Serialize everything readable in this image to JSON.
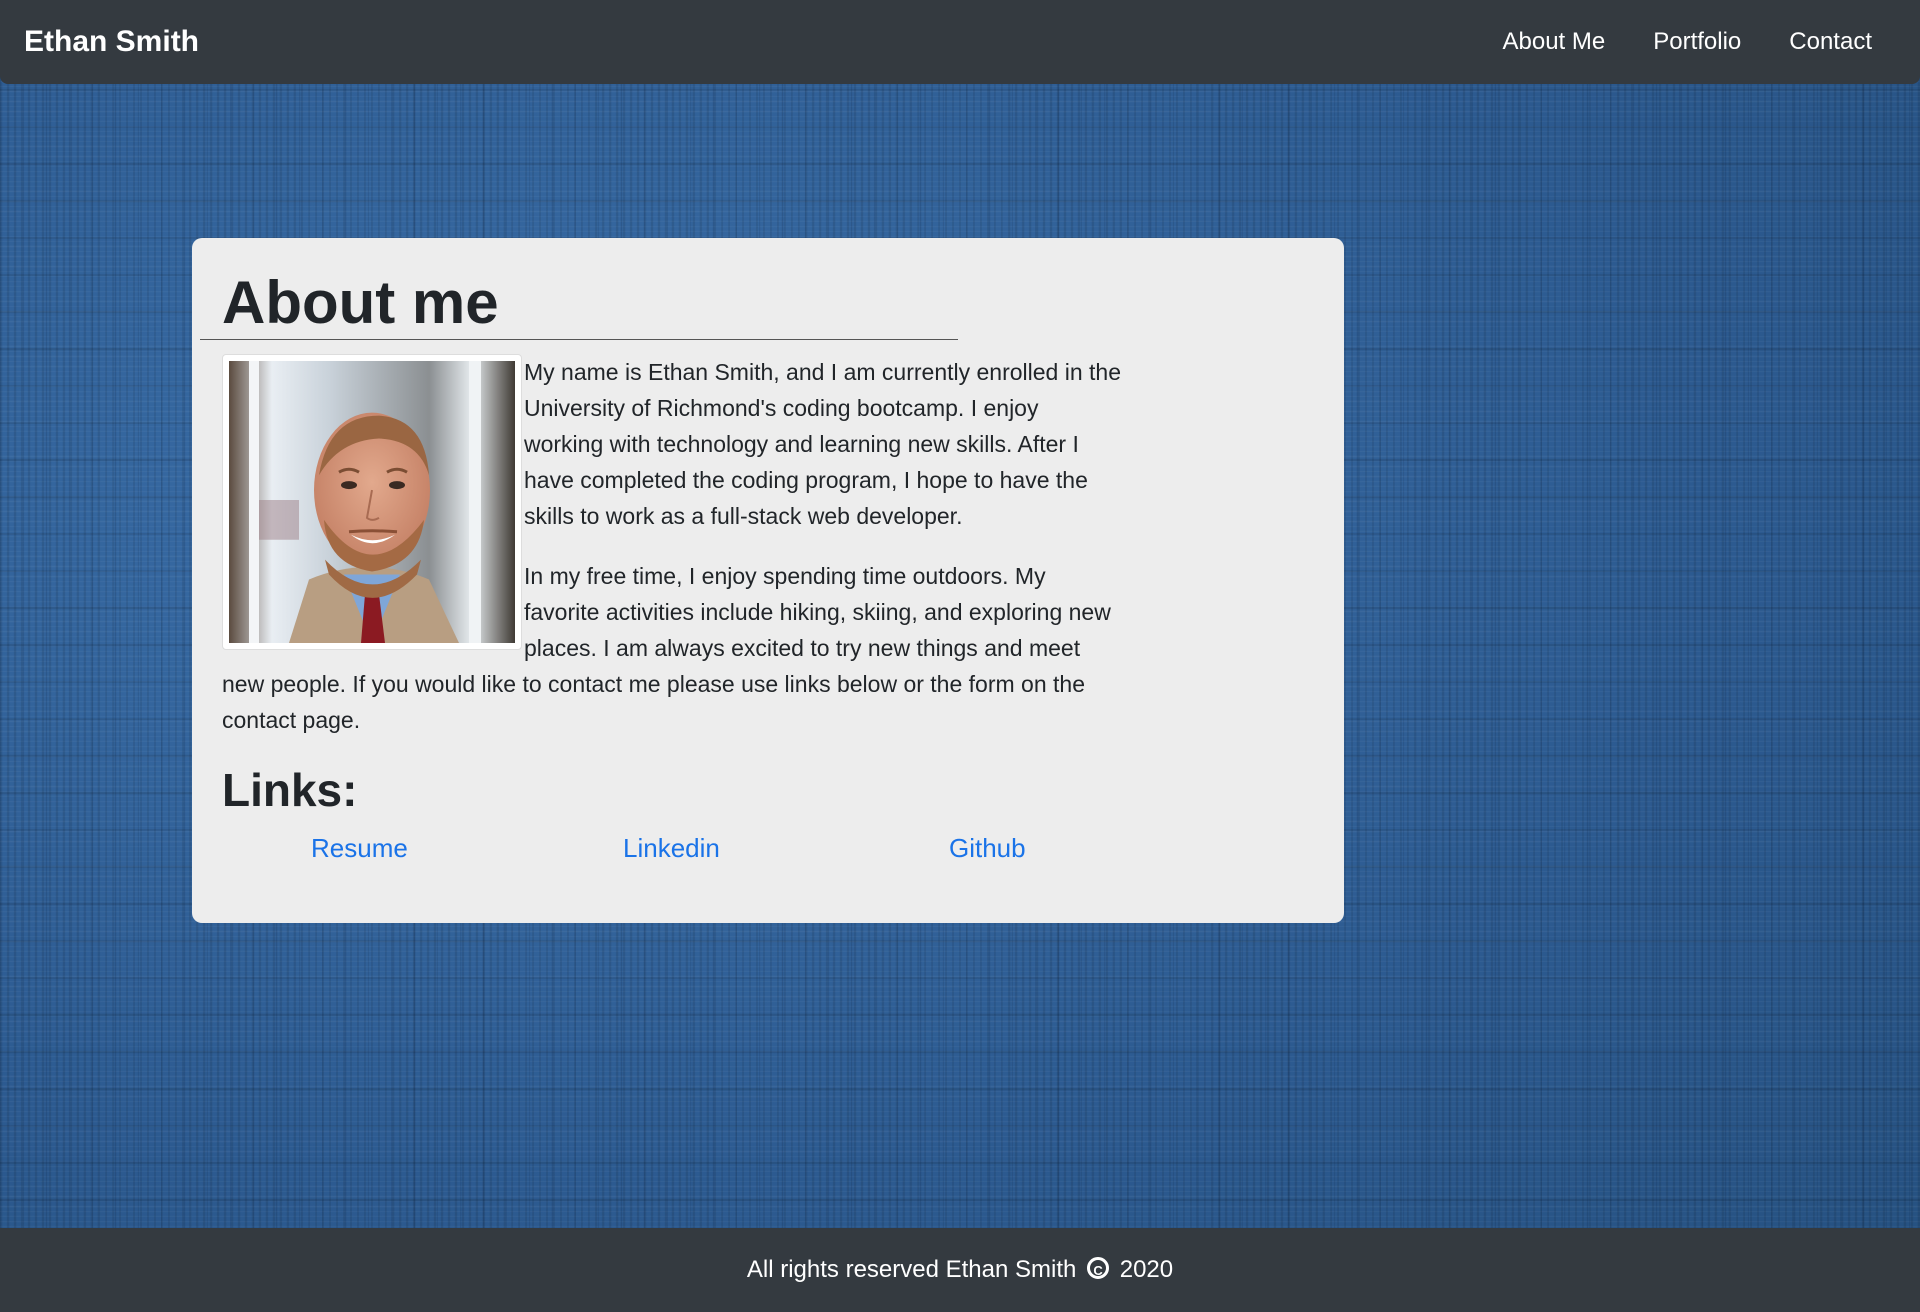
{
  "navbar": {
    "brand": "Ethan Smith",
    "links": [
      {
        "label": "About Me"
      },
      {
        "label": "Portfolio"
      },
      {
        "label": "Contact"
      }
    ]
  },
  "about": {
    "title": "About me",
    "paragraph_1": "My name is Ethan Smith, and I am currently enrolled in the University of Richmond's coding bootcamp. I enjoy working with technology and learning new skills. After I have completed the coding program, I hope to have the skills to work as a full-stack web developer.",
    "paragraph_2": "In my free time, I enjoy spending time outdoors. My favorite activities include hiking, skiing, and exploring new places. I am always excited to try new things and meet new people. If you would like to contact me please use links below or the form on the contact page.",
    "links_heading": "Links:",
    "links": [
      {
        "label": "Resume"
      },
      {
        "label": "Linkedin"
      },
      {
        "label": "Github"
      }
    ]
  },
  "footer": {
    "text_before": "All rights reserved Ethan Smith",
    "text_after": "2020"
  },
  "colors": {
    "navbar_bg": "#343a40",
    "card_bg": "#ededed",
    "link": "#1a73e8",
    "page_bg": "#2f5f98"
  }
}
